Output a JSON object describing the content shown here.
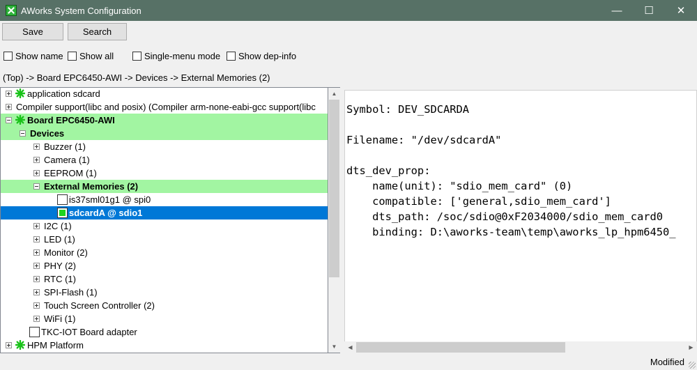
{
  "window": {
    "title": "AWorks System Configuration",
    "minimize_glyph": "—",
    "maximize_glyph": "☐",
    "close_glyph": "✕"
  },
  "toolbar": {
    "save_label": "Save",
    "search_label": "Search"
  },
  "options": [
    {
      "label": "Show name",
      "checked": false
    },
    {
      "label": "Show all",
      "checked": false
    },
    {
      "label": "Single-menu mode",
      "checked": false
    },
    {
      "label": "Show dep-info",
      "checked": false
    }
  ],
  "breadcrumb": "(Top) -> Board EPC6450-AWI -> Devices -> External Memories (2)",
  "tree": [
    {
      "label": "application sdcard",
      "expander": "plus",
      "icon": "star",
      "style": "normal"
    },
    {
      "label": "Compiler support(libc and posix) (Compiler arm-none-eabi-gcc support(libc",
      "expander": "plus",
      "icon": "none",
      "style": "normal"
    },
    {
      "label": "Board EPC6450-AWI",
      "expander": "minus",
      "icon": "star",
      "style": "green"
    },
    {
      "label": "Devices",
      "expander": "minus",
      "icon": "none",
      "style": "green"
    },
    {
      "label": "Buzzer (1)",
      "expander": "plus",
      "icon": "none",
      "style": "normal"
    },
    {
      "label": "Camera (1)",
      "expander": "plus",
      "icon": "none",
      "style": "normal"
    },
    {
      "label": "EEPROM (1)",
      "expander": "plus",
      "icon": "none",
      "style": "normal"
    },
    {
      "label": "External Memories (2)",
      "expander": "minus",
      "icon": "none",
      "style": "green"
    },
    {
      "label": "is37sml01g1 @ spi0",
      "expander": "none",
      "icon": "checkbox",
      "style": "normal"
    },
    {
      "label": "sdcardA @ sdio1",
      "expander": "none",
      "icon": "checkbox-checked",
      "style": "selected"
    },
    {
      "label": "I2C (1)",
      "expander": "plus",
      "icon": "none",
      "style": "normal"
    },
    {
      "label": "LED (1)",
      "expander": "plus",
      "icon": "none",
      "style": "normal"
    },
    {
      "label": "Monitor (2)",
      "expander": "plus",
      "icon": "none",
      "style": "normal"
    },
    {
      "label": "PHY (2)",
      "expander": "plus",
      "icon": "none",
      "style": "normal"
    },
    {
      "label": "RTC (1)",
      "expander": "plus",
      "icon": "none",
      "style": "normal"
    },
    {
      "label": "SPI-Flash (1)",
      "expander": "plus",
      "icon": "none",
      "style": "normal"
    },
    {
      "label": "Touch Screen Controller (2)",
      "expander": "plus",
      "icon": "none",
      "style": "normal"
    },
    {
      "label": "WiFi (1)",
      "expander": "plus",
      "icon": "none",
      "style": "normal"
    },
    {
      "label": "TKC-IOT Board adapter",
      "expander": "none",
      "icon": "checkbox",
      "style": "normal"
    },
    {
      "label": "HPM Platform",
      "expander": "plus",
      "icon": "star",
      "style": "normal"
    }
  ],
  "details": {
    "lines": [
      "Symbol: DEV_SDCARDA",
      "",
      "Filename: \"/dev/sdcardA\"",
      "",
      "dts_dev_prop:",
      "    name(unit): \"sdio_mem_card\" (0)",
      "    compatible: ['general,sdio_mem_card']",
      "    dts_path: /soc/sdio@0xF2034000/sdio_mem_card0",
      "    binding: D:\\aworks-team\\temp\\aworks_lp_hpm6450_"
    ]
  },
  "status": {
    "text": "Modified"
  },
  "colors": {
    "titlebar": "#577166",
    "highlight_green": "#a2f5a2",
    "selection_blue": "#0078d7",
    "star_green": "#19c219"
  }
}
